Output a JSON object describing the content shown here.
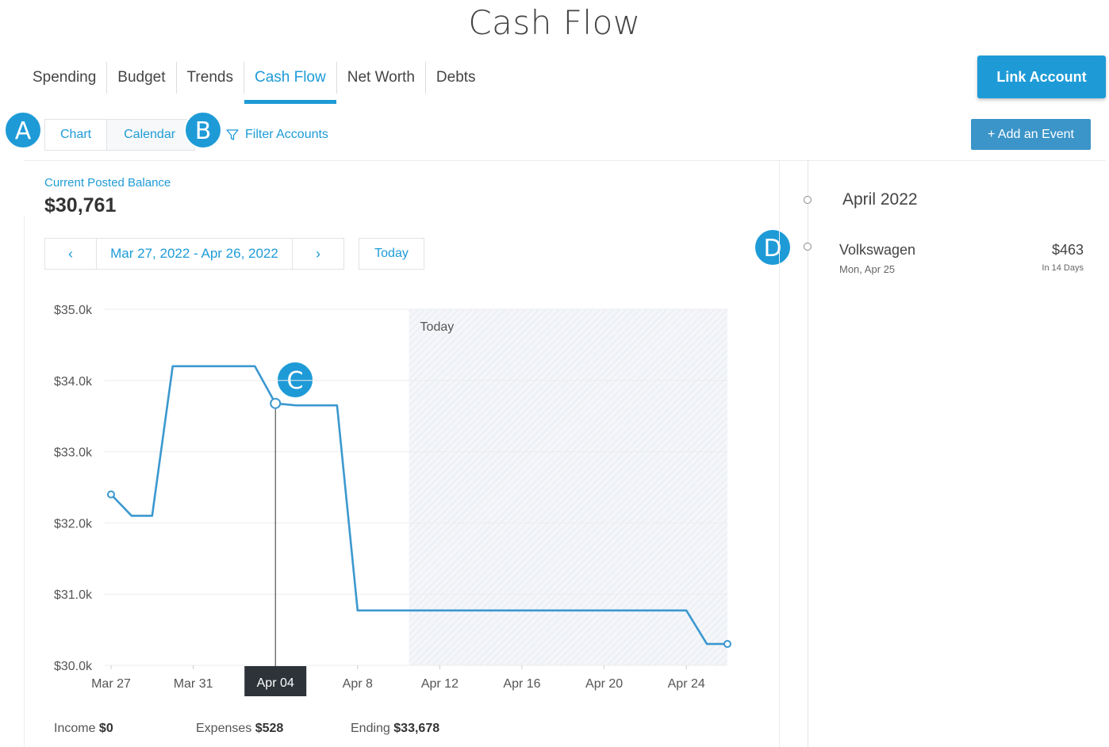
{
  "page_title": "Cash Flow",
  "tabs": [
    {
      "label": "Spending"
    },
    {
      "label": "Budget"
    },
    {
      "label": "Trends"
    },
    {
      "label": "Cash Flow",
      "active": true
    },
    {
      "label": "Net Worth"
    },
    {
      "label": "Debts"
    }
  ],
  "link_account_label": "Link Account",
  "view_toggle": {
    "chart": "Chart",
    "calendar": "Calendar"
  },
  "filter_label": "Filter Accounts",
  "add_event_label": "+ Add an Event",
  "markers": {
    "a": "A",
    "b": "B",
    "c": "C",
    "d": "D"
  },
  "balance": {
    "label": "Current Posted Balance",
    "value": "$30,761"
  },
  "date_nav": {
    "prev": "‹",
    "range": "Mar 27, 2022 - Apr 26, 2022",
    "next": "›",
    "today": "Today"
  },
  "chart_data": {
    "type": "line",
    "today_label": "Today",
    "y_ticks": [
      "$35.0k",
      "$34.0k",
      "$33.0k",
      "$32.0k",
      "$31.0k",
      "$30.0k"
    ],
    "ylim": [
      30000,
      35000
    ],
    "x_ticks": [
      "Mar 27",
      "Mar 31",
      "Apr 04",
      "Apr 8",
      "Apr 12",
      "Apr 16",
      "Apr 20",
      "Apr 24"
    ],
    "x_tick_days": [
      0,
      4,
      8,
      12,
      16,
      20,
      24,
      28
    ],
    "highlighted_tick": "Apr 04",
    "today_start_day": 14.5,
    "x_end_day": 30,
    "series": [
      {
        "x_day": [
          0,
          1,
          2,
          3,
          7,
          8,
          9,
          11,
          12,
          28,
          29,
          30
        ],
        "values": [
          32400,
          32100,
          32100,
          34200,
          34200,
          33678,
          33650,
          33650,
          30770,
          30770,
          30300,
          30300
        ]
      }
    ],
    "hover_point_day": 8,
    "colors": {
      "line": "#3b98d0",
      "grid": "#ececec",
      "tooltip": "#2d3339"
    }
  },
  "summary": {
    "income_label": "Income",
    "income_value": "$0",
    "expenses_label": "Expenses",
    "expenses_value": "$528",
    "ending_label": "Ending",
    "ending_value": "$33,678"
  },
  "timeline": {
    "month": "April 2022",
    "event": {
      "name": "Volkswagen",
      "date": "Mon, Apr 25",
      "amount": "$463",
      "days": "In 14 Days"
    }
  },
  "colors": {
    "accent": "#1e9bd7",
    "button": "#3b95c9"
  }
}
